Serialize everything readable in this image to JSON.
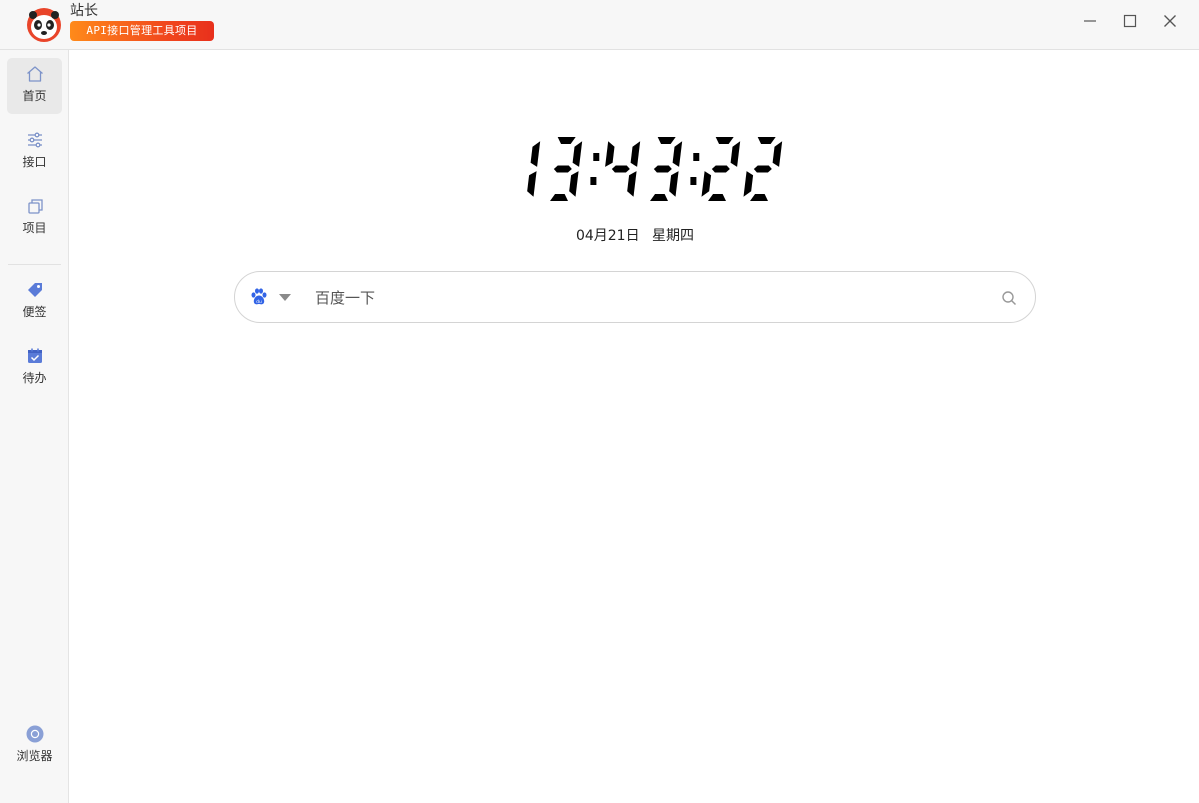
{
  "app": {
    "name": "站长",
    "badge": "API接口管理工具项目"
  },
  "window_controls": [
    "minimize",
    "maximize",
    "close"
  ],
  "sidebar": {
    "items": [
      {
        "label": "首页",
        "icon": "home-icon",
        "active": true
      },
      {
        "label": "接口",
        "icon": "sliders-icon",
        "active": false
      },
      {
        "label": "项目",
        "icon": "stack-icon",
        "active": false
      },
      {
        "label": "便签",
        "icon": "tag-icon",
        "active": false
      },
      {
        "label": "待办",
        "icon": "calendar-check-icon",
        "active": false
      }
    ],
    "bottom": {
      "label": "浏览器",
      "icon": "chrome-icon"
    }
  },
  "clock": {
    "time": "13:43:22",
    "date": "04月21日",
    "weekday": "星期四"
  },
  "search": {
    "engine": "baidu-icon",
    "placeholder": "百度一下",
    "value": ""
  },
  "colors": {
    "accent": "#4a6cf7",
    "badge_start": "#ff8a1a",
    "badge_end": "#e8301c",
    "sidebar_bg": "#f7f7f7",
    "icon_blue": "#5a7bd8"
  }
}
